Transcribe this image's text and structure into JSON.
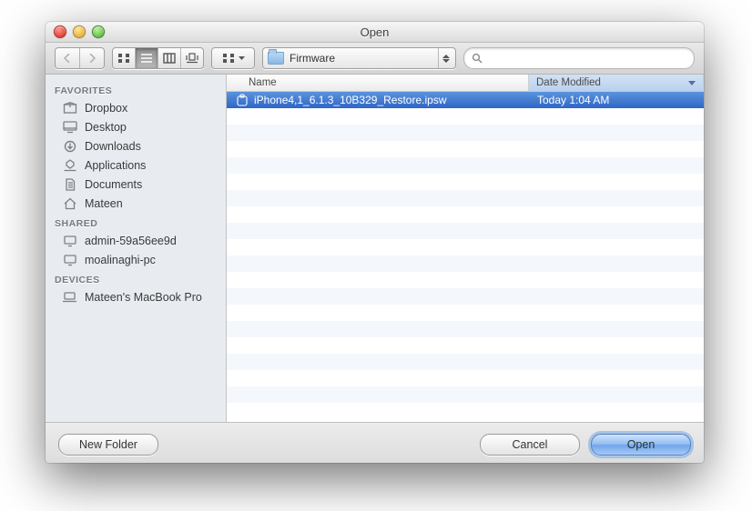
{
  "window": {
    "title": "Open"
  },
  "toolbar": {
    "folder": "Firmware",
    "search_placeholder": ""
  },
  "columns": {
    "name": "Name",
    "date": "Date Modified"
  },
  "files": [
    {
      "name": "iPhone4,1_6.1.3_10B329_Restore.ipsw",
      "date": "Today 1:04 AM",
      "selected": true
    }
  ],
  "sidebar": {
    "sections": [
      {
        "title": "FAVORITES",
        "items": [
          {
            "label": "Dropbox",
            "icon": "box"
          },
          {
            "label": "Desktop",
            "icon": "desktop"
          },
          {
            "label": "Downloads",
            "icon": "download"
          },
          {
            "label": "Applications",
            "icon": "apps"
          },
          {
            "label": "Documents",
            "icon": "doc"
          },
          {
            "label": "Mateen",
            "icon": "home"
          }
        ]
      },
      {
        "title": "SHARED",
        "items": [
          {
            "label": "admin-59a56ee9d",
            "icon": "display"
          },
          {
            "label": "moalinaghi-pc",
            "icon": "display"
          }
        ]
      },
      {
        "title": "DEVICES",
        "items": [
          {
            "label": "Mateen's MacBook Pro",
            "icon": "laptop"
          }
        ]
      }
    ]
  },
  "buttons": {
    "new_folder": "New Folder",
    "cancel": "Cancel",
    "open": "Open"
  }
}
